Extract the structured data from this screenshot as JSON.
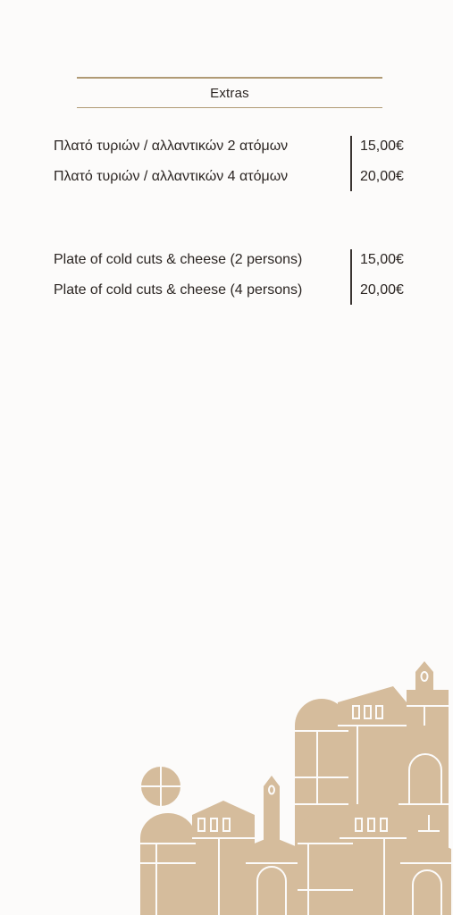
{
  "section": {
    "title": "Extras"
  },
  "greek_items": [
    {
      "name": "Πλατό τυριών / αλλαντικών 2 ατόμων",
      "price": "15,00€"
    },
    {
      "name": "Πλατό τυριών / αλλαντικών 4 ατόμων",
      "price": "20,00€"
    }
  ],
  "english_items": [
    {
      "name": "Plate of cold cuts & cheese (2 persons)",
      "price": "15,00€"
    },
    {
      "name": "Plate of cold cuts & cheese (4 persons)",
      "price": "20,00€"
    }
  ],
  "colors": {
    "accent": "#b09a74",
    "illustration": "#d5bc9c",
    "text": "#2b2522"
  },
  "illustration": {
    "subject": "stylized-town-buildings"
  }
}
